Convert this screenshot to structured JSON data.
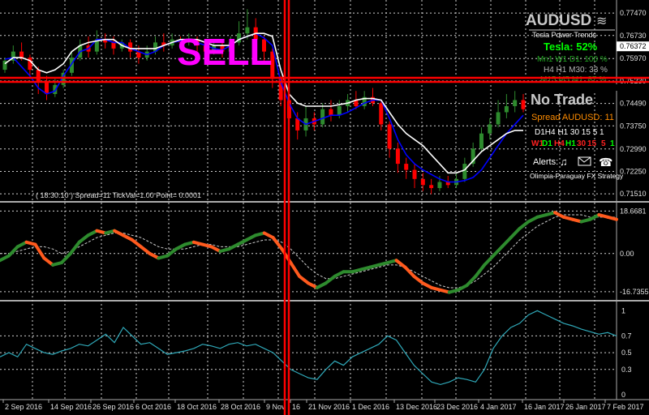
{
  "chart_data": [
    {
      "type": "candlestick",
      "symbol": "AUDUSD",
      "y_ticks": [
        "0.77470",
        "0.76730",
        "0.76372",
        "0.75970",
        "0.75230",
        "0.74490",
        "0.73750",
        "0.72990",
        "0.72250",
        "0.71510"
      ],
      "current_price": "0.76372",
      "ylim": [
        0.713,
        0.779
      ],
      "series": [
        {
          "name": "",
          "color": "#0000ff",
          "values": [
            0.7595,
            0.76,
            0.757,
            0.754,
            0.75,
            0.748,
            0.749,
            0.754,
            0.758,
            0.762,
            0.763,
            0.766,
            0.766,
            0.765,
            0.765,
            0.763,
            0.762,
            0.761,
            0.762,
            0.764,
            0.765,
            0.7655,
            0.766,
            0.765,
            0.764,
            0.763,
            0.7625,
            0.764,
            0.766,
            0.767,
            0.768,
            0.7665,
            0.764,
            0.752,
            0.745,
            0.74,
            0.738,
            0.739,
            0.74,
            0.741,
            0.741,
            0.742,
            0.7435,
            0.745,
            0.746,
            0.746,
            0.74,
            0.733,
            0.728,
            0.725,
            0.723,
            0.7215,
            0.72,
            0.719,
            0.719,
            0.7195,
            0.7205,
            0.723,
            0.727,
            0.731,
            0.735,
            0.738,
            0.741
          ]
        },
        {
          "name": "",
          "color": "#ffffff",
          "values": [
            0.758,
            0.76,
            0.76,
            0.759,
            0.756,
            0.755,
            0.756,
            0.758,
            0.762,
            0.764,
            0.765,
            0.7655,
            0.766,
            0.766,
            0.764,
            0.763,
            0.763,
            0.763,
            0.763,
            0.764,
            0.765,
            0.766,
            0.766,
            0.766,
            0.765,
            0.764,
            0.764,
            0.764,
            0.766,
            0.767,
            0.768,
            0.768,
            0.767,
            0.756,
            0.748,
            0.745,
            0.744,
            0.744,
            0.744,
            0.744,
            0.7445,
            0.745,
            0.746,
            0.7465,
            0.7465,
            0.746,
            0.742,
            0.738,
            0.735,
            0.733,
            0.731,
            0.728,
            0.725,
            0.722,
            0.722,
            0.723,
            0.726,
            0.729,
            0.731,
            0.733,
            0.735,
            0.736,
            0.736
          ]
        }
      ],
      "candles": [
        [
          0.756,
          0.759,
          0.76,
          0.755
        ],
        [
          0.759,
          0.762,
          0.764,
          0.758
        ],
        [
          0.762,
          0.76,
          0.765,
          0.759
        ],
        [
          0.76,
          0.756,
          0.761,
          0.753
        ],
        [
          0.756,
          0.752,
          0.757,
          0.748
        ],
        [
          0.752,
          0.748,
          0.754,
          0.746
        ],
        [
          0.748,
          0.751,
          0.753,
          0.747
        ],
        [
          0.751,
          0.755,
          0.756,
          0.75
        ],
        [
          0.755,
          0.76,
          0.762,
          0.754
        ],
        [
          0.76,
          0.764,
          0.766,
          0.759
        ],
        [
          0.764,
          0.762,
          0.767,
          0.76
        ],
        [
          0.762,
          0.766,
          0.769,
          0.761
        ],
        [
          0.766,
          0.765,
          0.768,
          0.763
        ],
        [
          0.765,
          0.763,
          0.767,
          0.761
        ],
        [
          0.763,
          0.765,
          0.766,
          0.762
        ],
        [
          0.765,
          0.762,
          0.766,
          0.76
        ],
        [
          0.762,
          0.76,
          0.764,
          0.758
        ],
        [
          0.76,
          0.762,
          0.764,
          0.759
        ],
        [
          0.762,
          0.765,
          0.767,
          0.761
        ],
        [
          0.765,
          0.764,
          0.768,
          0.762
        ],
        [
          0.764,
          0.766,
          0.768,
          0.763
        ],
        [
          0.766,
          0.765,
          0.767,
          0.763
        ],
        [
          0.765,
          0.766,
          0.768,
          0.764
        ],
        [
          0.766,
          0.764,
          0.767,
          0.762
        ],
        [
          0.764,
          0.762,
          0.765,
          0.76
        ],
        [
          0.762,
          0.764,
          0.765,
          0.761
        ],
        [
          0.764,
          0.762,
          0.766,
          0.76
        ],
        [
          0.762,
          0.765,
          0.767,
          0.761
        ],
        [
          0.765,
          0.768,
          0.772,
          0.764
        ],
        [
          0.768,
          0.77,
          0.776,
          0.766
        ],
        [
          0.77,
          0.766,
          0.773,
          0.764
        ],
        [
          0.766,
          0.762,
          0.767,
          0.759
        ],
        [
          0.762,
          0.753,
          0.763,
          0.75
        ],
        [
          0.753,
          0.746,
          0.754,
          0.744
        ],
        [
          0.746,
          0.74,
          0.748,
          0.738
        ],
        [
          0.74,
          0.736,
          0.742,
          0.733
        ],
        [
          0.736,
          0.74,
          0.744,
          0.734
        ],
        [
          0.74,
          0.738,
          0.742,
          0.736
        ],
        [
          0.738,
          0.743,
          0.745,
          0.737
        ],
        [
          0.743,
          0.741,
          0.746,
          0.739
        ],
        [
          0.741,
          0.744,
          0.746,
          0.74
        ],
        [
          0.744,
          0.746,
          0.748,
          0.742
        ],
        [
          0.746,
          0.744,
          0.749,
          0.743
        ],
        [
          0.744,
          0.747,
          0.749,
          0.743
        ],
        [
          0.747,
          0.745,
          0.75,
          0.744
        ],
        [
          0.745,
          0.738,
          0.746,
          0.736
        ],
        [
          0.738,
          0.73,
          0.739,
          0.727
        ],
        [
          0.73,
          0.725,
          0.732,
          0.722
        ],
        [
          0.725,
          0.723,
          0.727,
          0.72
        ],
        [
          0.723,
          0.72,
          0.725,
          0.717
        ],
        [
          0.72,
          0.718,
          0.722,
          0.716
        ],
        [
          0.718,
          0.717,
          0.72,
          0.715
        ],
        [
          0.717,
          0.719,
          0.721,
          0.716
        ],
        [
          0.719,
          0.718,
          0.721,
          0.717
        ],
        [
          0.718,
          0.72,
          0.722,
          0.717
        ],
        [
          0.72,
          0.725,
          0.727,
          0.719
        ],
        [
          0.725,
          0.73,
          0.732,
          0.724
        ],
        [
          0.73,
          0.735,
          0.737,
          0.729
        ],
        [
          0.735,
          0.738,
          0.74,
          0.733
        ],
        [
          0.738,
          0.742,
          0.746,
          0.737
        ],
        [
          0.742,
          0.744,
          0.748,
          0.74
        ],
        [
          0.744,
          0.746,
          0.749,
          0.742
        ],
        [
          0.746,
          0.743,
          0.748,
          0.742
        ]
      ]
    },
    {
      "type": "line",
      "y_ticks": [
        "18.6681",
        "0.00",
        "-16.7355"
      ],
      "ylim": [
        -20,
        22
      ],
      "series": [
        {
          "name": "",
          "color_up": "#2e8b2e",
          "color_down": "#ff5a1e",
          "values": [
            -3,
            -1,
            3,
            5,
            4,
            -2,
            -5,
            -4,
            0,
            5,
            8,
            10,
            9,
            10,
            8,
            6,
            3,
            0,
            -2,
            -1,
            2,
            4,
            5,
            4,
            3,
            1,
            2,
            4,
            6,
            8,
            9,
            7,
            2,
            -4,
            -10,
            -13,
            -15,
            -13,
            -10,
            -8,
            -8,
            -7,
            -6,
            -5,
            -4,
            -3,
            -6,
            -10,
            -13,
            -15,
            -16,
            -17,
            -16,
            -14,
            -10,
            -5,
            -1,
            3,
            7,
            11,
            14,
            16,
            17,
            18,
            16,
            15,
            14,
            15,
            17,
            16,
            15
          ]
        },
        {
          "name": "",
          "color": "#cccccc",
          "values": [
            0,
            0,
            1,
            2,
            3,
            3,
            2,
            0,
            1,
            3,
            5,
            7,
            8,
            9,
            9,
            8,
            7,
            5,
            3,
            2,
            2,
            2,
            3,
            4,
            4,
            3,
            3,
            3,
            4,
            5,
            6,
            6,
            5,
            2,
            -2,
            -6,
            -9,
            -11,
            -11,
            -10,
            -9,
            -8,
            -7,
            -6,
            -5,
            -5,
            -6,
            -8,
            -10,
            -12,
            -14,
            -15,
            -15,
            -14,
            -12,
            -9,
            -6,
            -2,
            2,
            6,
            9,
            12,
            14,
            16,
            17,
            17,
            17,
            16,
            16,
            16,
            16
          ]
        }
      ]
    },
    {
      "type": "line",
      "y_ticks": [
        "1",
        "0.7",
        "0.5",
        "0.3",
        "0"
      ],
      "ylim": [
        -0.05,
        1.1
      ],
      "series": [
        {
          "name": "",
          "color": "#2fa8b8",
          "values": [
            0.45,
            0.5,
            0.45,
            0.6,
            0.55,
            0.5,
            0.48,
            0.52,
            0.55,
            0.6,
            0.58,
            0.65,
            0.72,
            0.62,
            0.8,
            0.7,
            0.6,
            0.62,
            0.55,
            0.48,
            0.5,
            0.52,
            0.55,
            0.6,
            0.58,
            0.55,
            0.6,
            0.62,
            0.58,
            0.6,
            0.55,
            0.5,
            0.4,
            0.3,
            0.25,
            0.2,
            0.18,
            0.3,
            0.4,
            0.35,
            0.45,
            0.5,
            0.55,
            0.6,
            0.7,
            0.65,
            0.5,
            0.35,
            0.25,
            0.15,
            0.12,
            0.15,
            0.2,
            0.18,
            0.15,
            0.3,
            0.55,
            0.7,
            0.8,
            0.85,
            0.95,
            1.0,
            0.95,
            0.9,
            0.85,
            0.82,
            0.78,
            0.75,
            0.72,
            0.74,
            0.7
          ]
        }
      ]
    }
  ],
  "x_labels": [
    "2 Sep 2016",
    "14 Sep 2016",
    "26 Sep 2016",
    "6 Oct 2016",
    "18 Oct 2016",
    "28 Oct 2016",
    "9 Nov",
    "16",
    "21 Nov 2016",
    "1 Dec 2016",
    "13 Dec 2016",
    "23 Dec 2016",
    "4 Jan 2017",
    "16 Jan 2017",
    "26 Jan 2017",
    "7 Feb 2017"
  ],
  "signal_label": "SELL",
  "status_line": "( 18:30:10 )  Spread=11  TickVal=1.00  Point= 0.0001",
  "panel": {
    "symbol": "AUDUSD",
    "subtitle": "Tesla Power Trends",
    "tesla": "Tesla: 52%",
    "tf_line1": "Mn1 W1 D1: 100 %",
    "tf_line2": "H4 H1 M30: 33 %",
    "tf_line3": "M15 M5 M1: 87 %",
    "no_trade": "No Trade",
    "spread": "Spread AUDUSD:  11",
    "tf_row1": "D1H4 H1 30  15  5  1",
    "tf_row2": [
      "W1",
      "D1",
      "H4",
      "H1",
      "30",
      "15",
      "5",
      "1"
    ],
    "alerts": "Alerts:",
    "footer": "Olimpia-Paraguay FX Strategy"
  },
  "colors": {
    "up": "#2e8b2e",
    "down": "#ff0000",
    "red_line": "#ff0000",
    "sell": "#ff00ff",
    "tesla": "#00ff00",
    "spread": "#ff8c00"
  }
}
